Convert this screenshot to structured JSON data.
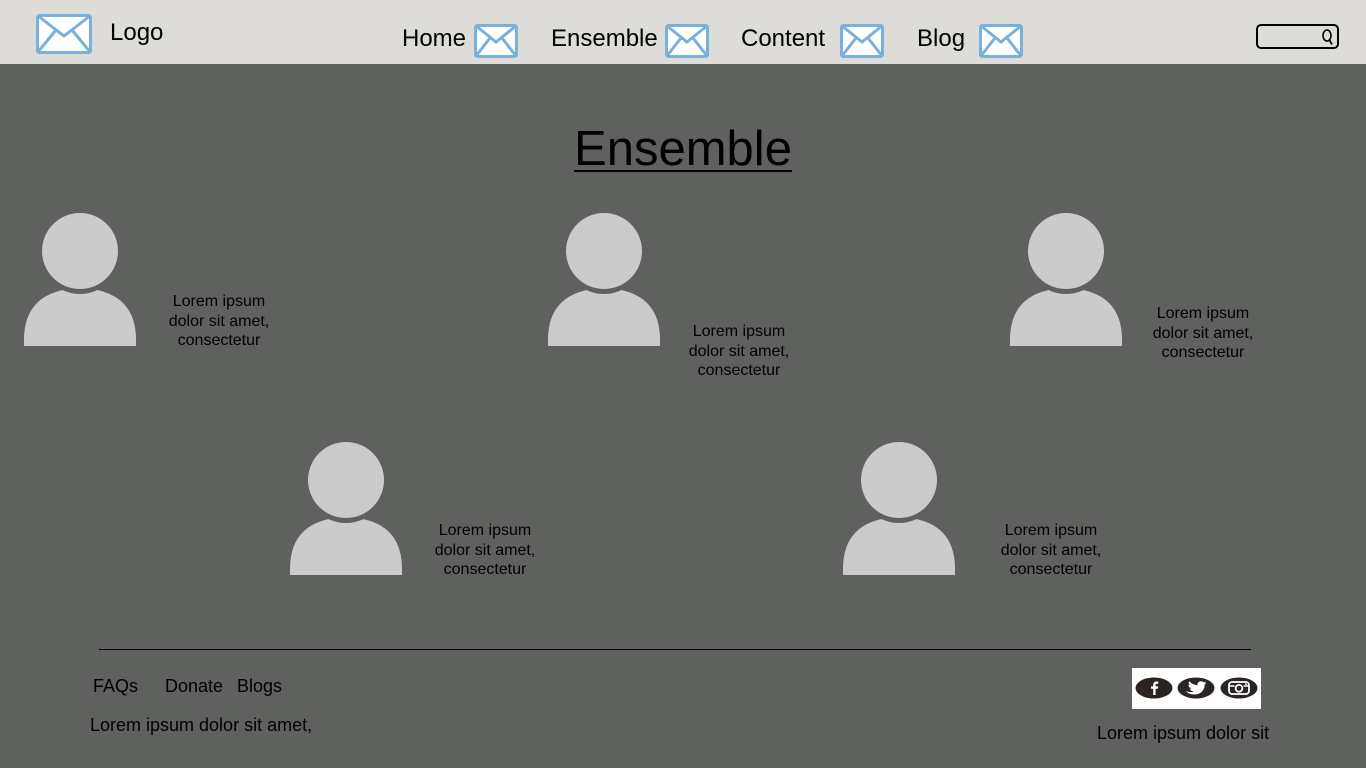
{
  "header": {
    "logo_text": "Logo",
    "nav": [
      {
        "label": "Home"
      },
      {
        "label": "Ensemble"
      },
      {
        "label": "Content"
      },
      {
        "label": "Blog"
      }
    ],
    "search": {
      "value": "",
      "placeholder": ""
    }
  },
  "main": {
    "title": "Ensemble",
    "members": [
      {
        "line1": "Lorem ipsum",
        "line2": "dolor sit amet,",
        "line3": "consectetur"
      },
      {
        "line1": "Lorem ipsum",
        "line2": "dolor sit amet,",
        "line3": "consectetur"
      },
      {
        "line1": "Lorem ipsum",
        "line2": "dolor sit amet,",
        "line3": "consectetur"
      },
      {
        "line1": "Lorem ipsum",
        "line2": "dolor sit amet,",
        "line3": "consectetur"
      },
      {
        "line1": "Lorem ipsum",
        "line2": "dolor sit amet,",
        "line3": "consectetur"
      }
    ]
  },
  "footer": {
    "links": [
      {
        "label": "FAQs"
      },
      {
        "label": "Donate"
      },
      {
        "label": "Blogs"
      }
    ],
    "text_left": "Lorem ipsum dolor sit amet,",
    "text_right": "Lorem ipsum dolor sit",
    "social_icons": [
      "facebook-icon",
      "twitter-icon",
      "instagram-icon"
    ]
  },
  "colors": {
    "header_bg": "#dedcd9",
    "page_bg": "#5f615e",
    "placeholder_blue": "#79b0dc",
    "avatar_gray": "#cbcbcb",
    "social_dark": "#2a2522"
  }
}
